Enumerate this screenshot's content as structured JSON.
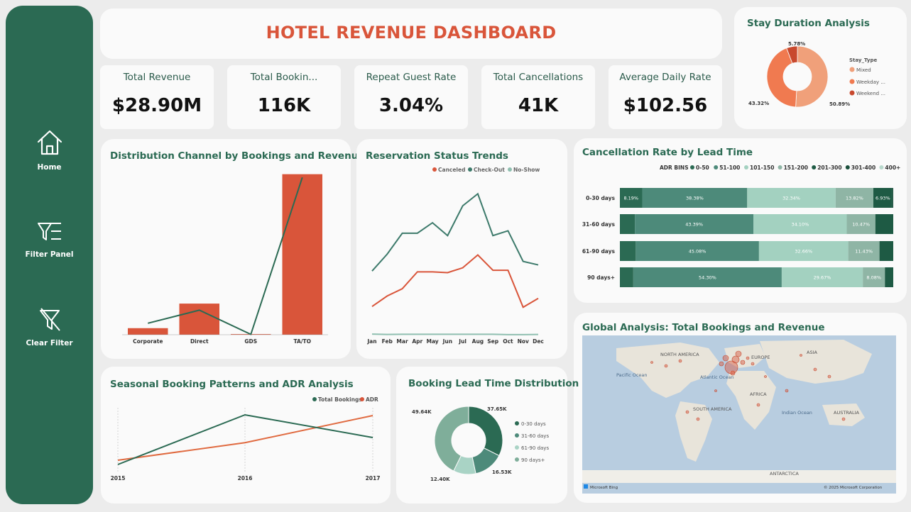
{
  "sidebar": {
    "items": [
      {
        "label": "Home",
        "icon": "home-icon"
      },
      {
        "label": "Filter Panel",
        "icon": "filter-list-icon"
      },
      {
        "label": "Clear Filter",
        "icon": "clear-filter-icon"
      }
    ]
  },
  "header": {
    "title": "HOTEL REVENUE DASHBOARD"
  },
  "kpis": [
    {
      "label": "Total Revenue",
      "value": "$28.90M"
    },
    {
      "label": "Total Bookin...",
      "value": "116K"
    },
    {
      "label": "Repeat Guest Rate",
      "value": "3.04%"
    },
    {
      "label": "Total Cancellations",
      "value": "41K"
    },
    {
      "label": "Average Daily Rate",
      "value": "$102.56"
    }
  ],
  "colors": {
    "brand_green": "#2b6a53",
    "accent_orange": "#d9553a",
    "background": "#ececec",
    "card": "#fafafa"
  },
  "stay": {
    "title": "Stay Duration Analysis",
    "legend_title": "Stay_Type",
    "legend": [
      "Mixed",
      "Weekday ...",
      "Weekend ..."
    ],
    "labels": [
      "50.89%",
      "43.32%",
      "5.78%"
    ]
  },
  "distribution": {
    "title": "Distribution Channel by Bookings and Revenue"
  },
  "reservation": {
    "title": "Reservation Status Trends",
    "legend": [
      "Canceled",
      "Check-Out",
      "No-Show"
    ]
  },
  "cancellation": {
    "title": "Cancellation Rate by Lead Time",
    "legend_title": "ADR BINS",
    "legend": [
      "0-50",
      "51-100",
      "101-150",
      "151-200",
      "201-300",
      "301-400",
      "400+"
    ]
  },
  "global": {
    "title": "Global Analysis: Total Bookings and Revenue",
    "map_labels": {
      "north_america": "NORTH AMERICA",
      "europe": "EUROPE",
      "asia": "ASIA",
      "pacific": "Pacific Ocean",
      "atlantic": "Atlantic Ocean",
      "africa": "AFRICA",
      "south_america": "SOUTH AMERICA",
      "indian": "Indian Ocean",
      "australia": "AUSTRALIA",
      "antarctica": "ANTARCTICA"
    },
    "bing": "Microsoft Bing",
    "copyright": "© 2025 Microsoft Corporation"
  },
  "seasonal": {
    "title": "Seasonal Booking Patterns and ADR Analysis",
    "legend": [
      "Total Bookings",
      "ADR"
    ]
  },
  "leadtime": {
    "title": "Booking Lead Time Distribution",
    "legend": [
      "0-30 days",
      "31-60 days",
      "61-90 days",
      "90 days+"
    ],
    "labels": [
      "37.65K",
      "16.53K",
      "12.40K",
      "49.64K"
    ]
  },
  "chart_data": [
    {
      "type": "bar",
      "title": "Distribution Channel by Bookings and Revenue",
      "categories": [
        "Corporate",
        "Direct",
        "GDS",
        "TA/TO"
      ],
      "series": [
        {
          "values": [
            2,
            9.5,
            0.2,
            49
          ]
        },
        {
          "values": [
            3.5,
            7.5,
            0.1,
            48
          ]
        }
      ],
      "note": "series values estimated as relative heights; combo bar + line chart"
    },
    {
      "type": "line",
      "title": "Reservation Status Trends",
      "categories": [
        "Jan",
        "Feb",
        "Mar",
        "Apr",
        "May",
        "Jun",
        "Jul",
        "Aug",
        "Sep",
        "Oct",
        "Nov",
        "Dec"
      ],
      "series": [
        {
          "name": "Canceled",
          "values": [
            1800,
            2450,
            2900,
            3950,
            3950,
            3900,
            4200,
            5000,
            4050,
            4050,
            1750,
            2300
          ]
        },
        {
          "name": "Check-Out",
          "values": [
            4000,
            5050,
            6350,
            6350,
            7000,
            6200,
            8050,
            8800,
            6200,
            6500,
            4600,
            4380
          ]
        },
        {
          "name": "No-Show",
          "values": [
            80,
            60,
            70,
            70,
            70,
            70,
            70,
            70,
            70,
            50,
            50,
            60
          ]
        }
      ],
      "legend": "top-center"
    },
    {
      "type": "bar",
      "title": "Cancellation Rate by Lead Time",
      "categories": [
        "0-30 days",
        "31-60 days",
        "61-90 days",
        "90 days+"
      ],
      "series_names": [
        "0-50",
        "51-100",
        "101-150",
        "151-200",
        "201-300",
        "301-400",
        "400+"
      ],
      "rows": [
        [
          {
            "bin": "0-50",
            "pct": 8.19,
            "label": "8.19%"
          },
          {
            "bin": "51-100",
            "pct": 38.38,
            "label": "38.38%"
          },
          {
            "bin": "101-150",
            "pct": 32.34,
            "label": "32.34%"
          },
          {
            "bin": "151-200",
            "pct": 13.82,
            "label": "13.82%"
          },
          {
            "bin": "201-300",
            "pct": 6.93,
            "label": "6.93%"
          },
          {
            "bin": "301-400",
            "pct": 0.34,
            "label": ""
          }
        ],
        [
          {
            "bin": "0-50",
            "pct": 5.5,
            "label": ""
          },
          {
            "bin": "51-100",
            "pct": 43.39,
            "label": "43.39%"
          },
          {
            "bin": "101-150",
            "pct": 34.1,
            "label": "34.10%"
          },
          {
            "bin": "151-200",
            "pct": 10.47,
            "label": "10.47%"
          },
          {
            "bin": "201-300",
            "pct": 6.54,
            "label": ""
          }
        ],
        [
          {
            "bin": "0-50",
            "pct": 5.8,
            "label": ""
          },
          {
            "bin": "51-100",
            "pct": 45.08,
            "label": "45.08%"
          },
          {
            "bin": "101-150",
            "pct": 32.66,
            "label": "32.66%"
          },
          {
            "bin": "151-200",
            "pct": 11.43,
            "label": "11.43%"
          },
          {
            "bin": "201-300",
            "pct": 5.03,
            "label": ""
          }
        ],
        [
          {
            "bin": "0-50",
            "pct": 4.9,
            "label": ""
          },
          {
            "bin": "51-100",
            "pct": 54.3,
            "label": "54.30%"
          },
          {
            "bin": "101-150",
            "pct": 29.67,
            "label": "29.67%"
          },
          {
            "bin": "151-200",
            "pct": 8.08,
            "label": "8.08%"
          },
          {
            "bin": "201-300",
            "pct": 3.05,
            "label": ""
          }
        ]
      ],
      "stacked": "100%",
      "orientation": "horizontal"
    },
    {
      "type": "line",
      "title": "Seasonal Booking Patterns and ADR Analysis",
      "categories": [
        "2015",
        "2016",
        "2017"
      ],
      "series": [
        {
          "name": "Total Bookings",
          "values": [
            21000,
            56000,
            40000
          ]
        },
        {
          "name": "ADR",
          "values": [
            88,
            99,
            116
          ]
        }
      ],
      "legend": "top-right"
    },
    {
      "type": "pie",
      "title": "Booking Lead Time Distribution",
      "labels": [
        "0-30 days",
        "31-60 days",
        "61-90 days",
        "90 days+"
      ],
      "values": [
        37.65,
        16.53,
        12.4,
        49.64
      ],
      "value_labels": [
        "37.65K",
        "16.53K",
        "12.40K",
        "49.64K"
      ],
      "donut": true
    },
    {
      "type": "pie",
      "title": "Stay Duration Analysis",
      "labels": [
        "Mixed",
        "Weekday ...",
        "Weekend ..."
      ],
      "values": [
        50.89,
        43.32,
        5.78
      ],
      "value_labels": [
        "50.89%",
        "43.32%",
        "5.78%"
      ],
      "donut": true
    }
  ]
}
